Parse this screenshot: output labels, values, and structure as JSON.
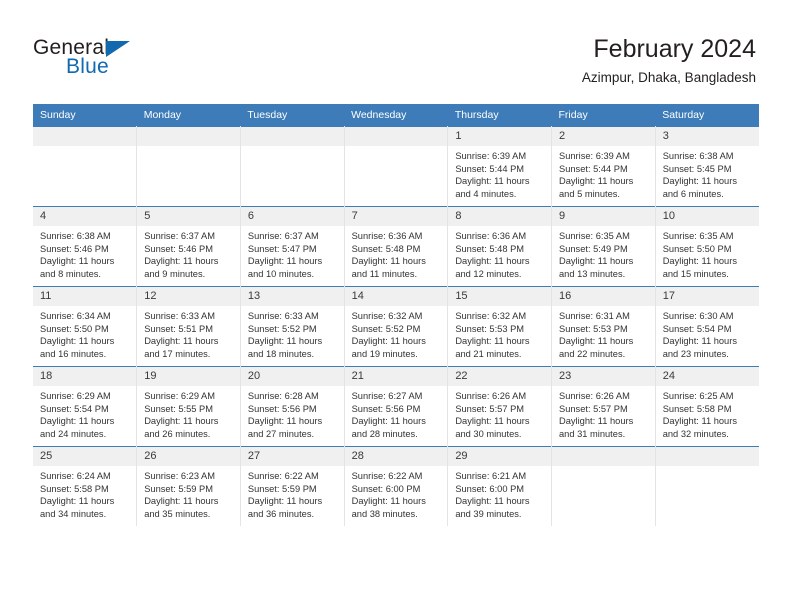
{
  "brand": {
    "word_one": "General",
    "word_two": "Blue",
    "accent_color": "#1269b0",
    "triangle_icon": "blue-triangle-icon"
  },
  "header": {
    "title": "February 2024",
    "subtitle": "Azimpur, Dhaka, Bangladesh"
  },
  "theme": {
    "header_row_bg": "#3d7cb8",
    "daynum_bg": "#f0f0f0",
    "cell_border": "#e4e4e4",
    "text": "#333333"
  },
  "columns": [
    "Sunday",
    "Monday",
    "Tuesday",
    "Wednesday",
    "Thursday",
    "Friday",
    "Saturday"
  ],
  "labels": {
    "sunrise": "Sunrise:",
    "sunset": "Sunset:",
    "daylight": "Daylight:"
  },
  "weeks": [
    [
      {
        "day": "",
        "empty": true
      },
      {
        "day": "",
        "empty": true
      },
      {
        "day": "",
        "empty": true
      },
      {
        "day": "",
        "empty": true
      },
      {
        "day": "1",
        "sunrise": "Sunrise: 6:39 AM",
        "sunset": "Sunset: 5:44 PM",
        "daylight": "Daylight: 11 hours and 4 minutes."
      },
      {
        "day": "2",
        "sunrise": "Sunrise: 6:39 AM",
        "sunset": "Sunset: 5:44 PM",
        "daylight": "Daylight: 11 hours and 5 minutes."
      },
      {
        "day": "3",
        "sunrise": "Sunrise: 6:38 AM",
        "sunset": "Sunset: 5:45 PM",
        "daylight": "Daylight: 11 hours and 6 minutes."
      }
    ],
    [
      {
        "day": "4",
        "sunrise": "Sunrise: 6:38 AM",
        "sunset": "Sunset: 5:46 PM",
        "daylight": "Daylight: 11 hours and 8 minutes."
      },
      {
        "day": "5",
        "sunrise": "Sunrise: 6:37 AM",
        "sunset": "Sunset: 5:46 PM",
        "daylight": "Daylight: 11 hours and 9 minutes."
      },
      {
        "day": "6",
        "sunrise": "Sunrise: 6:37 AM",
        "sunset": "Sunset: 5:47 PM",
        "daylight": "Daylight: 11 hours and 10 minutes."
      },
      {
        "day": "7",
        "sunrise": "Sunrise: 6:36 AM",
        "sunset": "Sunset: 5:48 PM",
        "daylight": "Daylight: 11 hours and 11 minutes."
      },
      {
        "day": "8",
        "sunrise": "Sunrise: 6:36 AM",
        "sunset": "Sunset: 5:48 PM",
        "daylight": "Daylight: 11 hours and 12 minutes."
      },
      {
        "day": "9",
        "sunrise": "Sunrise: 6:35 AM",
        "sunset": "Sunset: 5:49 PM",
        "daylight": "Daylight: 11 hours and 13 minutes."
      },
      {
        "day": "10",
        "sunrise": "Sunrise: 6:35 AM",
        "sunset": "Sunset: 5:50 PM",
        "daylight": "Daylight: 11 hours and 15 minutes."
      }
    ],
    [
      {
        "day": "11",
        "sunrise": "Sunrise: 6:34 AM",
        "sunset": "Sunset: 5:50 PM",
        "daylight": "Daylight: 11 hours and 16 minutes."
      },
      {
        "day": "12",
        "sunrise": "Sunrise: 6:33 AM",
        "sunset": "Sunset: 5:51 PM",
        "daylight": "Daylight: 11 hours and 17 minutes."
      },
      {
        "day": "13",
        "sunrise": "Sunrise: 6:33 AM",
        "sunset": "Sunset: 5:52 PM",
        "daylight": "Daylight: 11 hours and 18 minutes."
      },
      {
        "day": "14",
        "sunrise": "Sunrise: 6:32 AM",
        "sunset": "Sunset: 5:52 PM",
        "daylight": "Daylight: 11 hours and 19 minutes."
      },
      {
        "day": "15",
        "sunrise": "Sunrise: 6:32 AM",
        "sunset": "Sunset: 5:53 PM",
        "daylight": "Daylight: 11 hours and 21 minutes."
      },
      {
        "day": "16",
        "sunrise": "Sunrise: 6:31 AM",
        "sunset": "Sunset: 5:53 PM",
        "daylight": "Daylight: 11 hours and 22 minutes."
      },
      {
        "day": "17",
        "sunrise": "Sunrise: 6:30 AM",
        "sunset": "Sunset: 5:54 PM",
        "daylight": "Daylight: 11 hours and 23 minutes."
      }
    ],
    [
      {
        "day": "18",
        "sunrise": "Sunrise: 6:29 AM",
        "sunset": "Sunset: 5:54 PM",
        "daylight": "Daylight: 11 hours and 24 minutes."
      },
      {
        "day": "19",
        "sunrise": "Sunrise: 6:29 AM",
        "sunset": "Sunset: 5:55 PM",
        "daylight": "Daylight: 11 hours and 26 minutes."
      },
      {
        "day": "20",
        "sunrise": "Sunrise: 6:28 AM",
        "sunset": "Sunset: 5:56 PM",
        "daylight": "Daylight: 11 hours and 27 minutes."
      },
      {
        "day": "21",
        "sunrise": "Sunrise: 6:27 AM",
        "sunset": "Sunset: 5:56 PM",
        "daylight": "Daylight: 11 hours and 28 minutes."
      },
      {
        "day": "22",
        "sunrise": "Sunrise: 6:26 AM",
        "sunset": "Sunset: 5:57 PM",
        "daylight": "Daylight: 11 hours and 30 minutes."
      },
      {
        "day": "23",
        "sunrise": "Sunrise: 6:26 AM",
        "sunset": "Sunset: 5:57 PM",
        "daylight": "Daylight: 11 hours and 31 minutes."
      },
      {
        "day": "24",
        "sunrise": "Sunrise: 6:25 AM",
        "sunset": "Sunset: 5:58 PM",
        "daylight": "Daylight: 11 hours and 32 minutes."
      }
    ],
    [
      {
        "day": "25",
        "sunrise": "Sunrise: 6:24 AM",
        "sunset": "Sunset: 5:58 PM",
        "daylight": "Daylight: 11 hours and 34 minutes."
      },
      {
        "day": "26",
        "sunrise": "Sunrise: 6:23 AM",
        "sunset": "Sunset: 5:59 PM",
        "daylight": "Daylight: 11 hours and 35 minutes."
      },
      {
        "day": "27",
        "sunrise": "Sunrise: 6:22 AM",
        "sunset": "Sunset: 5:59 PM",
        "daylight": "Daylight: 11 hours and 36 minutes."
      },
      {
        "day": "28",
        "sunrise": "Sunrise: 6:22 AM",
        "sunset": "Sunset: 6:00 PM",
        "daylight": "Daylight: 11 hours and 38 minutes."
      },
      {
        "day": "29",
        "sunrise": "Sunrise: 6:21 AM",
        "sunset": "Sunset: 6:00 PM",
        "daylight": "Daylight: 11 hours and 39 minutes."
      },
      {
        "day": "",
        "empty": true
      },
      {
        "day": "",
        "empty": true
      }
    ]
  ]
}
